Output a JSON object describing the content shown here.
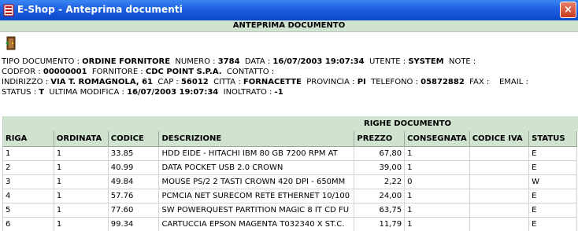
{
  "window": {
    "title": "E-Shop - Anteprima documenti",
    "close_label": "×"
  },
  "header_band": "ANTEPRIMA DOCUMENTO",
  "info": {
    "line1": [
      {
        "label": "TIPO DOCUMENTO : ",
        "value": "ORDINE FORNITORE"
      },
      {
        "label": "  NUMERO : ",
        "value": "3784"
      },
      {
        "label": "  DATA : ",
        "value": "16/07/2003 19:07:34"
      },
      {
        "label": "  UTENTE : ",
        "value": "SYSTEM"
      },
      {
        "label": "  NOTE :",
        "value": ""
      }
    ],
    "line2": [
      {
        "label": "CODFOR : ",
        "value": "00000001"
      },
      {
        "label": "  FORNITORE : ",
        "value": "CDC POINT S.P.A."
      },
      {
        "label": "  CONTATTO :",
        "value": ""
      }
    ],
    "line3": [
      {
        "label": "INDIRIZZO : ",
        "value": "VIA T. ROMAGNOLA, 61"
      },
      {
        "label": "  CAP : ",
        "value": "56012"
      },
      {
        "label": "  CITTA : ",
        "value": "FORNACETTE"
      },
      {
        "label": "  PROVINCIA : ",
        "value": "PI"
      },
      {
        "label": "  TELEFONO : ",
        "value": "05872882"
      },
      {
        "label": "  FAX :",
        "value": ""
      },
      {
        "label": "    EMAIL :",
        "value": ""
      }
    ],
    "line4": [
      {
        "label": "STATUS : ",
        "value": "T"
      },
      {
        "label": "  ULTIMA MODIFICA : ",
        "value": "16/07/2003 19:07:34"
      },
      {
        "label": "  INOLTRATO : ",
        "value": "-1"
      }
    ]
  },
  "grid": {
    "band_title": "RIGHE DOCUMENTO",
    "columns": [
      "RIGA",
      "ORDINATA",
      "CODICE",
      "DESCRIZIONE",
      "PREZZO",
      "CONSEGNATA",
      "CODICE IVA",
      "STATUS"
    ],
    "rows": [
      [
        "1",
        "1",
        "33.85",
        "HDD EIDE - HITACHI IBM 80 GB 7200 RPM AT",
        "67,80",
        "1",
        "",
        "E"
      ],
      [
        "2",
        "1",
        "40.99",
        "DATA POCKET USB 2.0 CROWN",
        "39,00",
        "1",
        "",
        "E"
      ],
      [
        "3",
        "1",
        "49.84",
        "MOUSE PS/2 2 TASTI CROWN 420 DPI - 650MM",
        "2,22",
        "0",
        "",
        "W"
      ],
      [
        "4",
        "1",
        "57.76",
        "PCMCIA NET SURECOM RETE ETHERNET 10/100",
        "24,00",
        "1",
        "",
        "E"
      ],
      [
        "5",
        "1",
        "77.60",
        "SW POWERQUEST PARTITION MAGIC 8 IT CD FU",
        "63,75",
        "1",
        "",
        "E"
      ],
      [
        "6",
        "1",
        "99.34",
        "CARTUCCIA EPSON MAGENTA T032340 X ST.C.",
        "11,79",
        "1",
        "",
        "E"
      ]
    ]
  }
}
